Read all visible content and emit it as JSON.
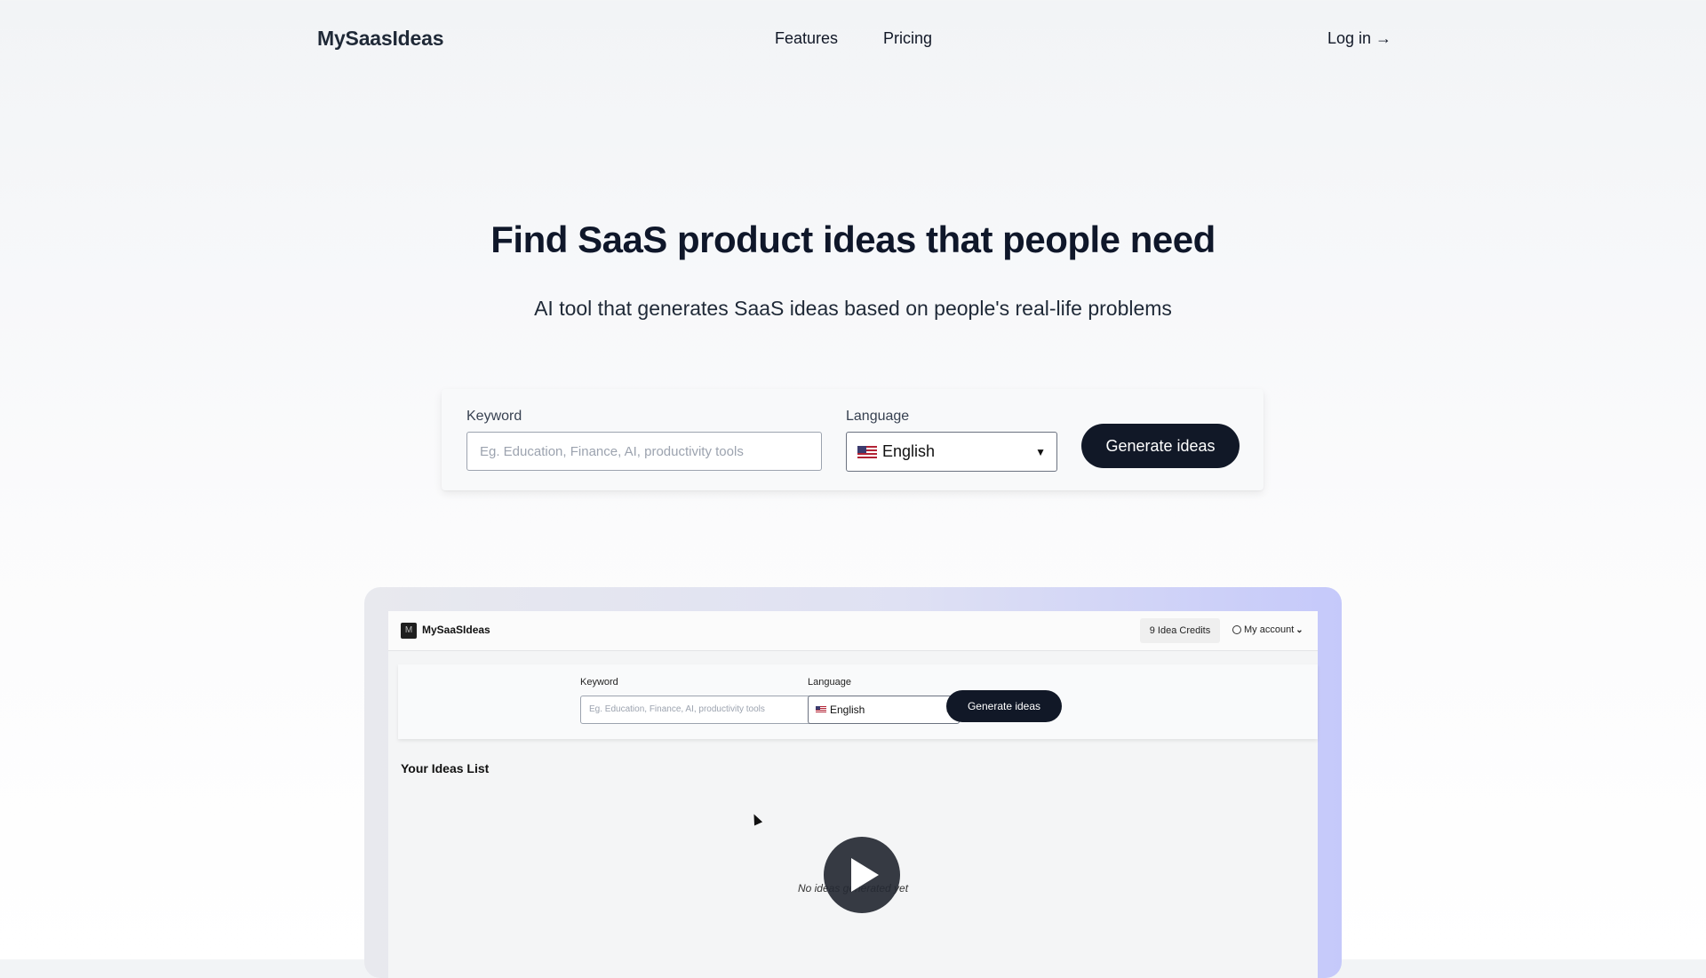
{
  "header": {
    "logo": "MySaasIdeas",
    "nav": [
      "Features",
      "Pricing"
    ],
    "login": "Log in →"
  },
  "hero": {
    "title": "Find SaaS product ideas that people need",
    "subtitle": "AI tool that generates SaaS ideas based on people's real-life problems"
  },
  "form": {
    "keyword_label": "Keyword",
    "keyword_placeholder": "Eg. Education, Finance, AI, productivity tools",
    "language_label": "Language",
    "language_value": "English",
    "submit_label": "Generate ideas"
  },
  "preview": {
    "logo": "MySaaSIdeas",
    "credits": "9 Idea Credits",
    "account": "My account",
    "keyword_label": "Keyword",
    "keyword_placeholder": "Eg. Education, Finance, AI, productivity tools",
    "language_label": "Language",
    "language_value": "English",
    "submit_label": "Generate ideas",
    "ideas_title": "Your Ideas List",
    "empty_text": "No ideas generated yet"
  },
  "icons": {
    "flag": "us-flag-icon",
    "play": "play-icon",
    "account": "user-circle-icon",
    "chevron": "chevron-down-icon"
  },
  "colors": {
    "primary_button": "#111827",
    "preview_gradient_end": "#c5c9fa"
  }
}
